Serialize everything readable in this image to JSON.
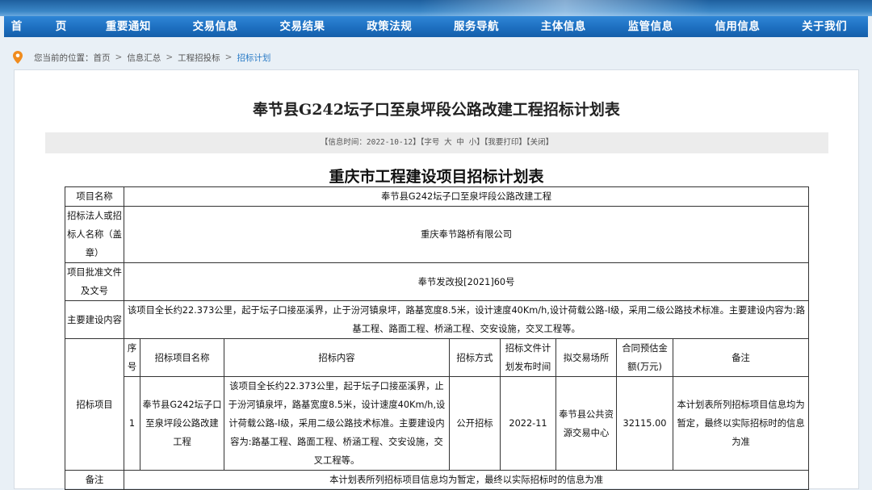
{
  "nav": {
    "items": [
      "首　页",
      "重要通知",
      "交易信息",
      "交易结果",
      "政策法规",
      "服务导航",
      "主体信息",
      "监管信息",
      "信用信息",
      "关于我们"
    ]
  },
  "breadcrumb": {
    "prefix": "您当前的位置：",
    "items": [
      "首页",
      "信息汇总",
      "工程招投标"
    ],
    "current": "招标计划",
    "separator": ">"
  },
  "article": {
    "title": "奉节县G242坛子口至泉坪段公路改建工程招标计划表",
    "info": {
      "time_label": "【信息时间：2022-10-12】",
      "font_label": "【字号",
      "font_large": "大",
      "font_mid": "中",
      "font_small": "小】",
      "print_label": "【我要打印】",
      "close_label": "【关闭】"
    },
    "subtitle": "重庆市工程建设项目招标计划表"
  },
  "table": {
    "project_name_label": "项目名称",
    "project_name": "奉节县G242坛子口至泉坪段公路改建工程",
    "tenderer_label": "招标法人或招标人名称（盖章）",
    "tenderer": "重庆奉节路桥有限公司",
    "approval_label": "项目批准文件及文号",
    "approval": "奉节发改投[2021]60号",
    "content_label": "主要建设内容",
    "content": "该项目全长约22.373公里，起于坛子口接巫溪界，止于汾河镇泉坪，路基宽度8.5米，设计速度40Km/h,设计荷载公路-I级，采用二级公路技术标准。主要建设内容为:路基工程、路面工程、桥涵工程、交安设施，交叉工程等。",
    "items_label": "招标项目",
    "headers": {
      "seq": "序号",
      "name": "招标项目名称",
      "scope": "招标内容",
      "method": "招标方式",
      "publish_time": "招标文件计划发布时间",
      "venue": "拟交易场所",
      "amount": "合同预估金额(万元)",
      "remark": "备注"
    },
    "rows": [
      {
        "seq": "1",
        "name": "奉节县G242坛子口至泉坪段公路改建工程",
        "scope": "该项目全长约22.373公里，起于坛子口接巫溪界，止于汾河镇泉坪，路基宽度8.5米，设计速度40Km/h,设计荷载公路-I级，采用二级公路技术标准。主要建设内容为:路基工程、路面工程、桥涵工程、交安设施，交叉工程等。",
        "method": "公开招标",
        "publish_time": "2022-11",
        "venue": "奉节县公共资源交易中心",
        "amount": "32115.00",
        "remark": "本计划表所列招标项目信息均为暂定，最终以实际招标时的信息为准"
      }
    ],
    "note_label": "备注",
    "note": "本计划表所列招标项目信息均为暂定，最终以实际招标时的信息为准"
  }
}
